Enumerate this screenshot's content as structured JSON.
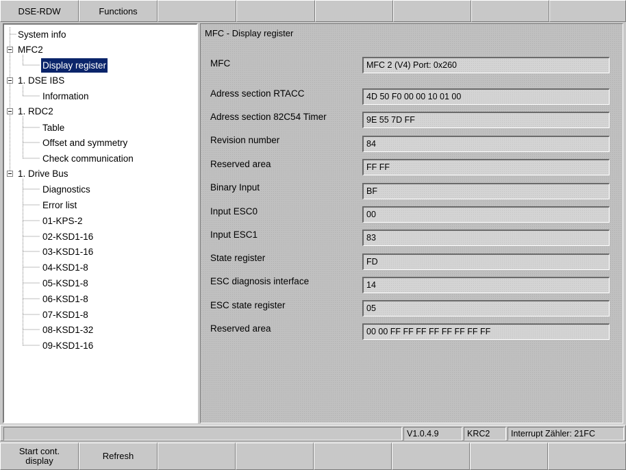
{
  "menu": {
    "items": [
      "DSE-RDW",
      "Functions",
      "",
      "",
      "",
      "",
      "",
      "",
      ""
    ]
  },
  "tree": {
    "nodes": [
      {
        "label": "System info"
      },
      {
        "label": "MFC2"
      },
      {
        "label": "Display register",
        "selected": true
      },
      {
        "label": "1. DSE IBS"
      },
      {
        "label": "Information"
      },
      {
        "label": "1. RDC2"
      },
      {
        "label": "Table"
      },
      {
        "label": "Offset and symmetry"
      },
      {
        "label": "Check communication"
      },
      {
        "label": "1. Drive Bus"
      },
      {
        "label": "Diagnostics"
      },
      {
        "label": "Error list"
      },
      {
        "label": "01-KPS-2"
      },
      {
        "label": "02-KSD1-16"
      },
      {
        "label": "03-KSD1-16"
      },
      {
        "label": "04-KSD1-8"
      },
      {
        "label": "05-KSD1-8"
      },
      {
        "label": "06-KSD1-8"
      },
      {
        "label": "07-KSD1-8"
      },
      {
        "label": "08-KSD1-32"
      },
      {
        "label": "09-KSD1-16"
      }
    ]
  },
  "panel": {
    "title": "MFC - Display register",
    "rows": [
      {
        "label": "MFC",
        "value": "MFC 2 (V4) Port: 0x260"
      },
      {
        "label": "Adress section RTACC",
        "value": "4D 50 F0 00 00 10 01 00"
      },
      {
        "label": "Adress section 82C54 Timer",
        "value": "9E 55 7D FF"
      },
      {
        "label": "Revision number",
        "value": "84"
      },
      {
        "label": "Reserved area",
        "value": "FF FF"
      },
      {
        "label": "Binary Input",
        "value": "BF"
      },
      {
        "label": "Input ESC0",
        "value": "00"
      },
      {
        "label": "Input ESC1",
        "value": "83"
      },
      {
        "label": "State register",
        "value": "FD"
      },
      {
        "label": "ESC diagnosis interface",
        "value": "14"
      },
      {
        "label": "ESC state register",
        "value": "05"
      },
      {
        "label": "Reserved area",
        "value": "00 00 FF FF FF FF FF FF FF FF"
      }
    ]
  },
  "status": {
    "version": "V1.0.4.9",
    "robot": "KRC2",
    "interrupt": "Interrupt Zähler: 21FC"
  },
  "softkeys": [
    "Start cont.\ndisplay",
    "Refresh",
    "",
    "",
    "",
    "",
    "",
    ""
  ]
}
